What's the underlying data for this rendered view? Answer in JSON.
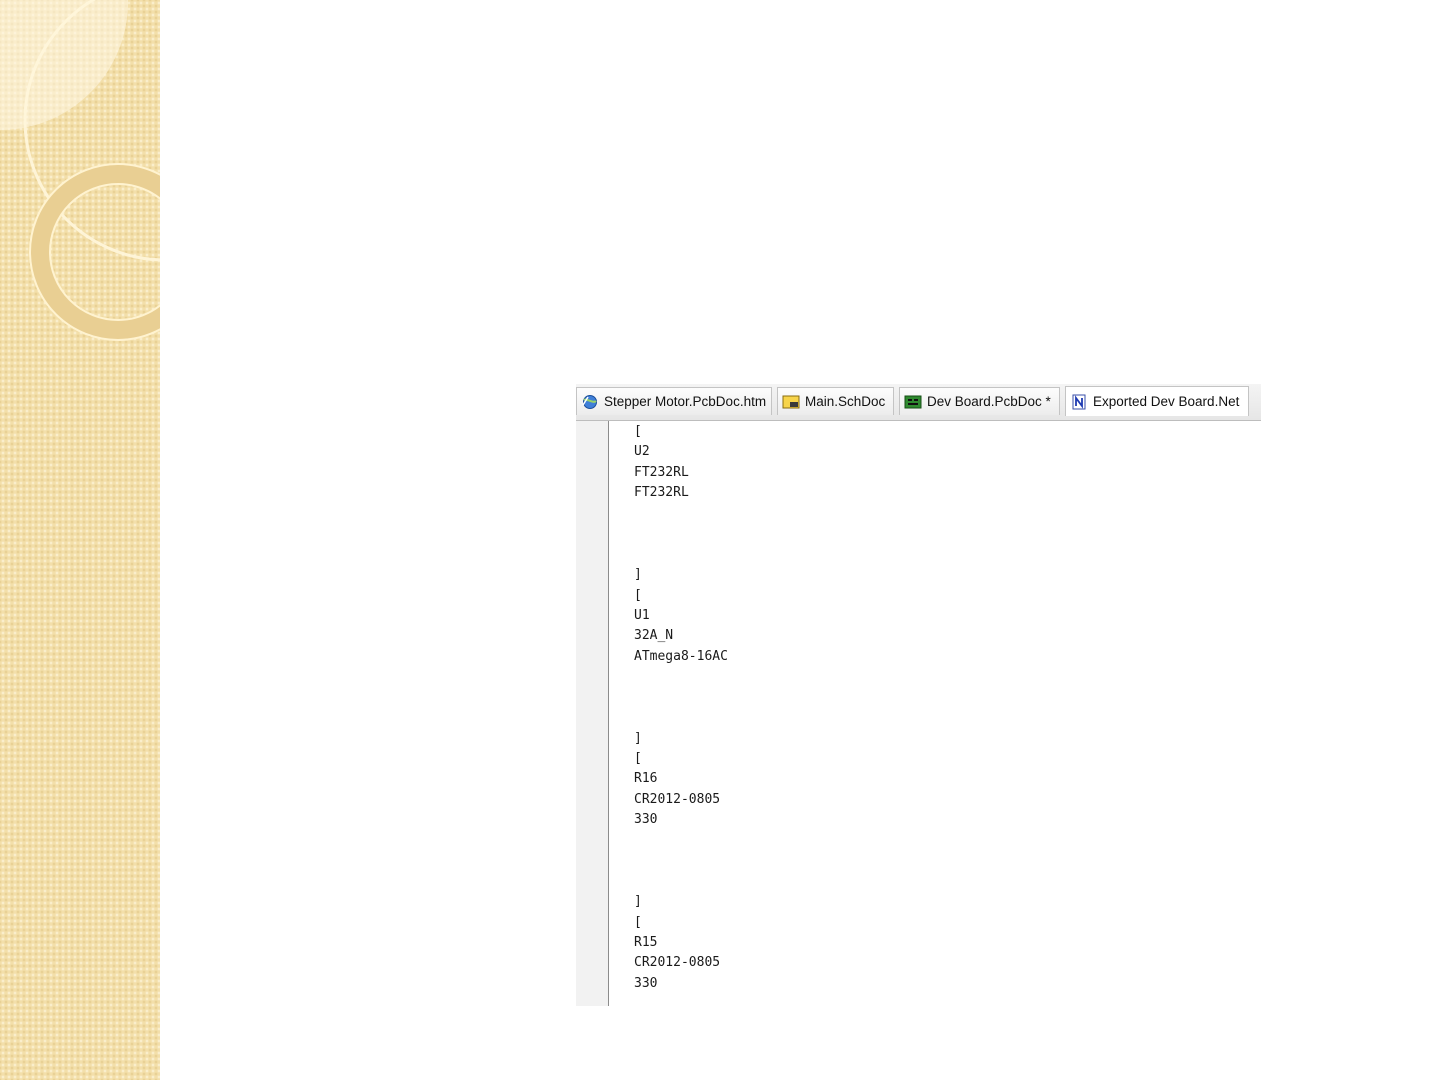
{
  "tabs": [
    {
      "label": "Stepper Motor.PcbDoc.htm",
      "icon": "web-page-icon"
    },
    {
      "label": "Main.SchDoc",
      "icon": "schematic-doc-icon"
    },
    {
      "label": "Dev Board.PcbDoc *",
      "icon": "pcb-doc-icon"
    },
    {
      "label": "Exported Dev Board.Net",
      "icon": "netlist-doc-icon",
      "active": true
    }
  ],
  "lines": [
    "[",
    "U2",
    "FT232RL",
    "FT232RL",
    "",
    "",
    "",
    "]",
    "[",
    "U1",
    "32A_N",
    "ATmega8-16AC",
    "",
    "",
    "",
    "]",
    "[",
    "R16",
    "CR2012-0805",
    "330",
    "",
    "",
    "",
    "]",
    "[",
    "R15",
    "CR2012-0805",
    "330"
  ],
  "colors": {
    "sidebar": "#f3dfaa",
    "ring": "#fff6dc"
  }
}
